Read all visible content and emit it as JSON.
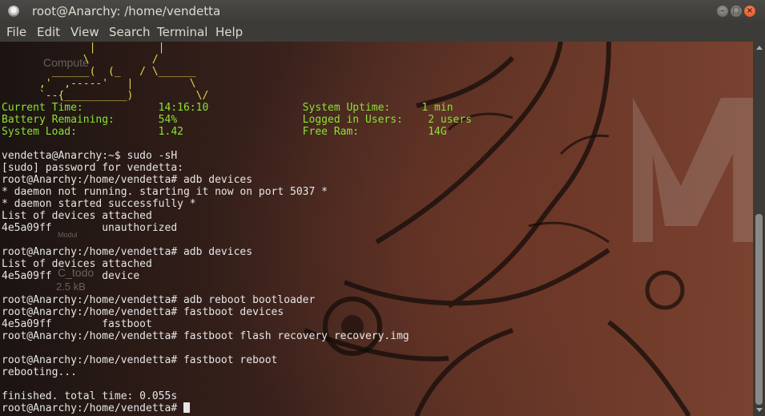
{
  "window": {
    "title": "root@Anarchy: /home/vendetta",
    "controls": {
      "minimize": "–",
      "maximize": "□",
      "close": "×"
    }
  },
  "menu": {
    "items": [
      "File",
      "Edit",
      "View",
      "Search",
      "Terminal",
      "Help"
    ]
  },
  "desktop_ghosts": {
    "computer_label": "Compute",
    "file_icon_label": "Modul",
    "file_name": "C_todo",
    "file_size": "2.5 kB",
    "logo_letter": "M"
  },
  "terminal": {
    "ascii_art": [
      "              |          |",
      "             \\          /",
      "        ______(  (_   / \\______",
      "      ,'  ,-----'   |         \\",
      "      `--{__________)          \\/"
    ],
    "sysinfo": [
      "Current Time:            14:16:10               System Uptime:     1 min",
      "Battery Remaining:       54%                    Logged in Users:    2 users",
      "System Load:             1.42                   Free Ram:           14G"
    ],
    "lines": [
      "",
      "vendetta@Anarchy:~$ sudo -sH",
      "[sudo] password for vendetta:",
      "root@Anarchy:/home/vendetta# adb devices",
      "* daemon not running. starting it now on port 5037 *",
      "* daemon started successfully *",
      "List of devices attached",
      "4e5a09ff        unauthorized",
      "",
      "root@Anarchy:/home/vendetta# adb devices",
      "List of devices attached",
      "4e5a09ff        device",
      "",
      "root@Anarchy:/home/vendetta# adb reboot bootloader",
      "root@Anarchy:/home/vendetta# fastboot devices",
      "4e5a09ff        fastboot",
      "root@Anarchy:/home/vendetta# fastboot flash recovery recovery.img",
      "",
      "root@Anarchy:/home/vendetta# fastboot reboot",
      "rebooting...",
      "",
      "finished. total time: 0.055s"
    ],
    "prompt": "root@Anarchy:/home/vendetta# "
  }
}
